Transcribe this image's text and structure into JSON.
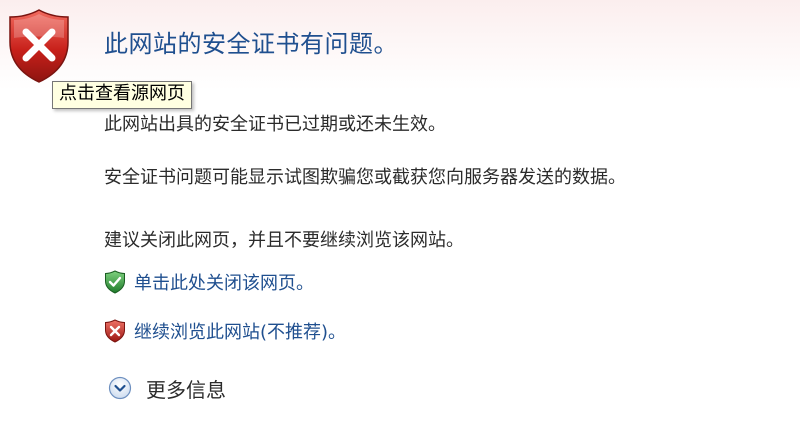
{
  "header": {
    "title": "此网站的安全证书有问题。"
  },
  "tooltip": {
    "text": "点击查看源网页"
  },
  "body": {
    "line1": "此网站出具的安全证书已过期或还未生效。",
    "line2": "安全证书问题可能显示试图欺骗您或截获您向服务器发送的数据。",
    "line3": "建议关闭此网页，并且不要继续浏览该网站。"
  },
  "actions": {
    "close_page": "单击此处关闭该网页。",
    "continue_site": "继续浏览此网站(不推荐)。"
  },
  "more_info": {
    "label": "更多信息"
  },
  "colors": {
    "title_blue": "#1f4f8f",
    "shield_red": "#c8211b",
    "shield_green": "#2f9a3b",
    "tooltip_bg": "#ffffe1"
  }
}
